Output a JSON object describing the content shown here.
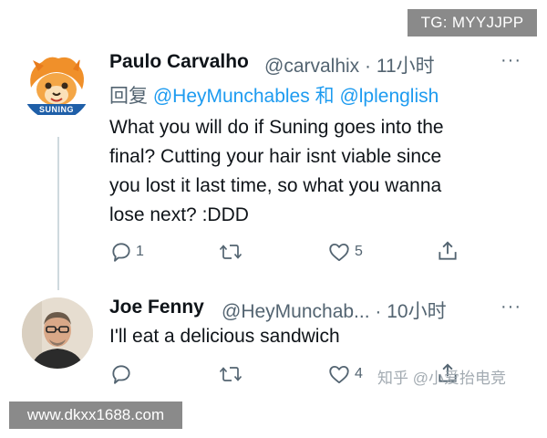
{
  "watermarks": {
    "top": "TG: MYYJJPP",
    "bottom": "www.dkxx1688.com",
    "zhihu": "知乎 @小爱抬电竞"
  },
  "tweet1": {
    "display_name": "Paulo Carvalho",
    "handle_time": "@carvalhix · 11小时",
    "reply_prefix": "回复",
    "mention1": "@HeyMunchables",
    "conj": "和",
    "mention2": "@lplenglish",
    "text": "What you will do if Suning goes into the\nfinal? Cutting your hair isnt viable since\nyou lost it last time, so what you wanna\nlose next? :DDD",
    "reply_count": "1",
    "retweet_count": "",
    "like_count": "5",
    "logo_text": "SUNING",
    "more": "···"
  },
  "tweet2": {
    "display_name": "Joe Fenny",
    "handle_time": "@HeyMunchab... · 10小时",
    "text": "I'll eat a delicious sandwich",
    "reply_count": "",
    "like_count": "4",
    "more": "···"
  },
  "colors": {
    "accent": "#1d9bf0",
    "muted": "#536471",
    "text": "#0f1419",
    "logo_blue": "#1f5fa8",
    "logo_orange": "#f0902a"
  }
}
